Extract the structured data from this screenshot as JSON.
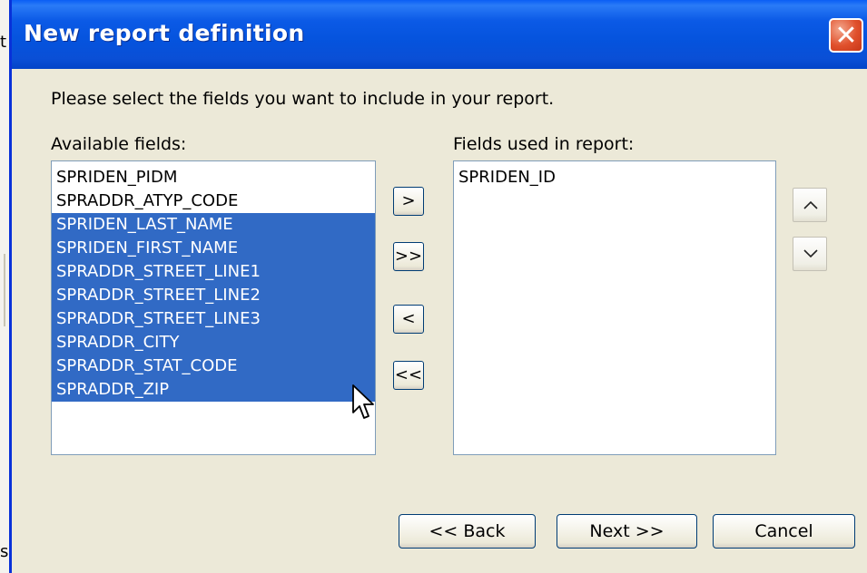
{
  "window": {
    "title": "New report definition"
  },
  "edge_glyphs": {
    "top": "t",
    "bottom": "s"
  },
  "instruction": "Please select the fields you want to include in your report.",
  "available": {
    "label": "Available fields:",
    "items": [
      {
        "text": "SPRIDEN_PIDM",
        "selected": false
      },
      {
        "text": "SPRADDR_ATYP_CODE",
        "selected": false
      },
      {
        "text": "SPRIDEN_LAST_NAME",
        "selected": true
      },
      {
        "text": "SPRIDEN_FIRST_NAME",
        "selected": true
      },
      {
        "text": "SPRADDR_STREET_LINE1",
        "selected": true
      },
      {
        "text": "SPRADDR_STREET_LINE2",
        "selected": true
      },
      {
        "text": "SPRADDR_STREET_LINE3",
        "selected": true
      },
      {
        "text": "SPRADDR_CITY",
        "selected": true
      },
      {
        "text": "SPRADDR_STAT_CODE",
        "selected": true
      },
      {
        "text": "SPRADDR_ZIP",
        "selected": true
      }
    ]
  },
  "used": {
    "label": "Fields used in report:",
    "items": [
      {
        "text": "SPRIDEN_ID",
        "selected": false
      }
    ]
  },
  "move_buttons": {
    "add": ">",
    "add_all": ">>",
    "remove": "<",
    "remove_all": "<<"
  },
  "order_buttons": {
    "up_icon": "chevron-up-icon",
    "down_icon": "chevron-down-icon"
  },
  "footer": {
    "back": "<< Back",
    "next": "Next >>",
    "cancel": "Cancel"
  },
  "close_glyph": "✕",
  "colors": {
    "selection": "#316ac5",
    "titlebar": "#0553dd",
    "dialog_bg": "#ece9d8"
  }
}
